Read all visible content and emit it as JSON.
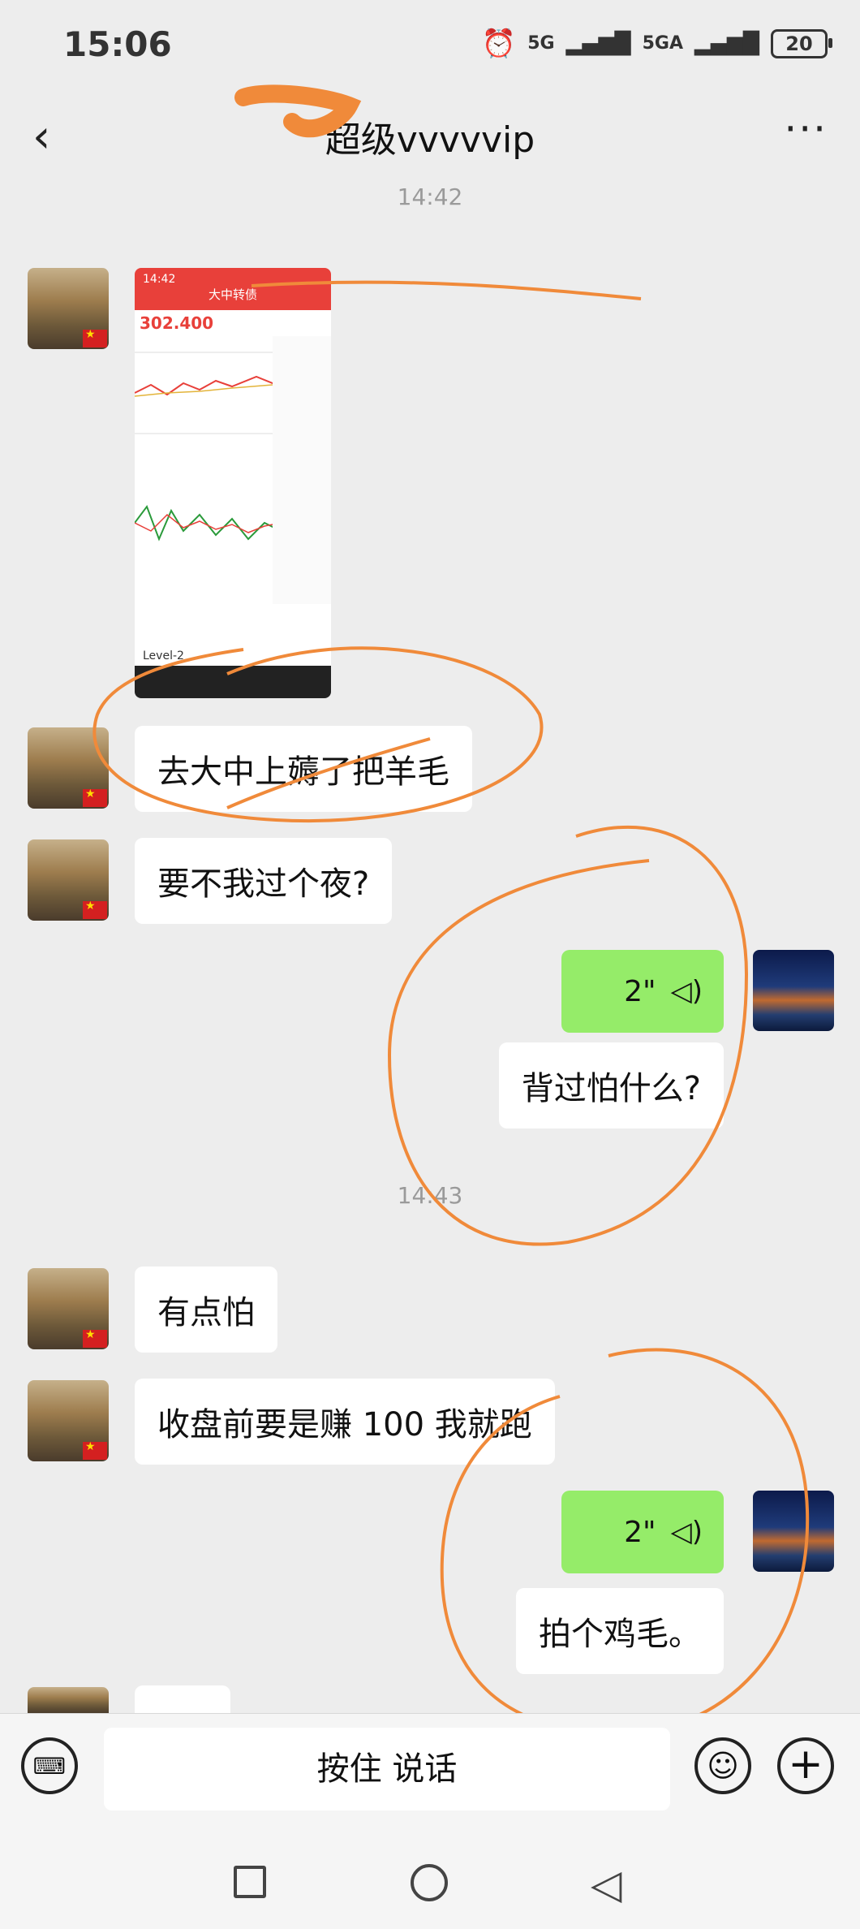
{
  "status_bar": {
    "time": "15:06",
    "signal1": "5G",
    "signal2": "5GA",
    "battery": "20"
  },
  "header": {
    "title": "超级vvvvvip"
  },
  "messages": {
    "ts1": "14:42",
    "ts2": "14:43",
    "m1": "去大中上薅了把羊毛",
    "m2": "要不我过个夜?",
    "v1": "2\"",
    "m3": "背过怕什么?",
    "m4": "有点怕",
    "m5": "收盘前要是赚 100 我就跑",
    "v2": "2\"",
    "m6": "拍个鸡毛。"
  },
  "screenshot_thumb": {
    "app_title": "大中转债",
    "time": "14:42",
    "price": "302.400",
    "level": "Level-2"
  },
  "input": {
    "speak_label": "按住 说话"
  },
  "colors": {
    "green_bubble": "#95ec69",
    "background": "#ededed",
    "annotation": "#f08a3a"
  }
}
